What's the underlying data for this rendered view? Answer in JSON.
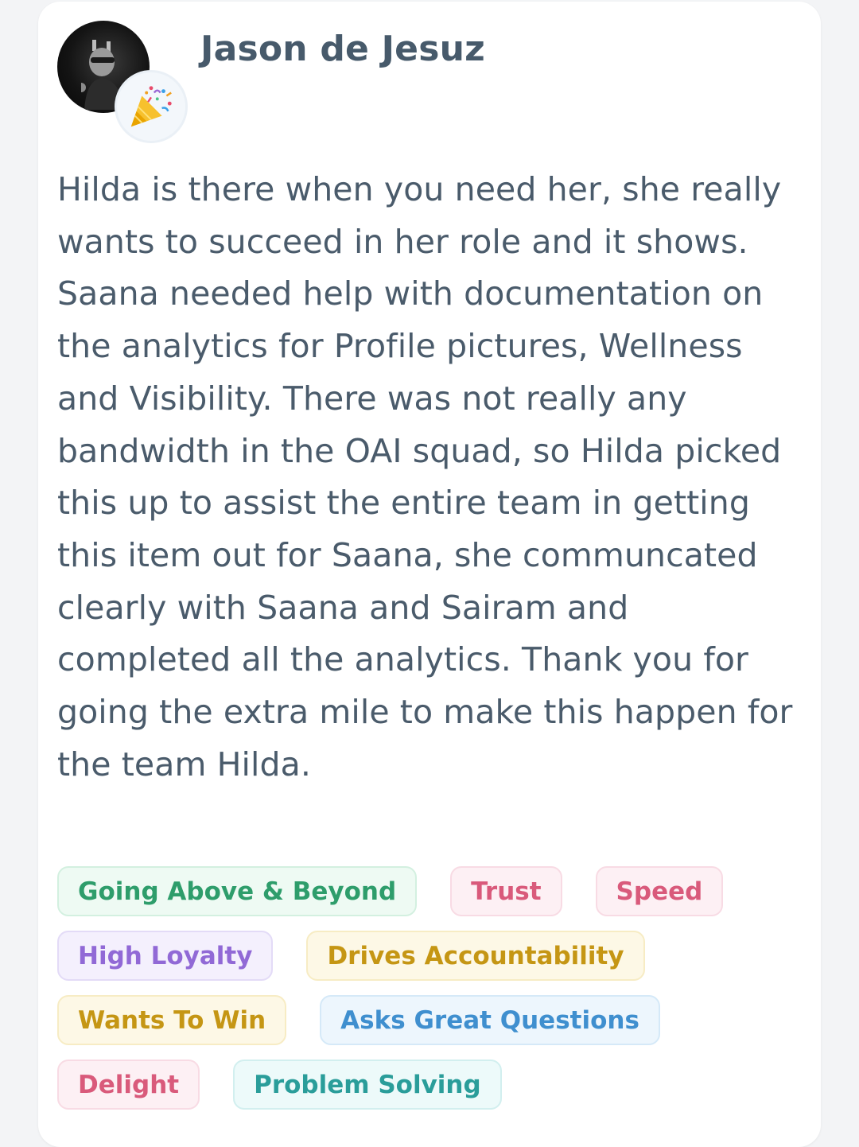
{
  "author": {
    "name": "Jason de Jesuz",
    "badge_icon": "party-popper-icon"
  },
  "message": "Hilda is there when you need her, she really wants to succeed in her role and it shows. Saana needed help with documentation on the analytics for Profile pictures, Wellness and Visibility. There was not really any bandwidth in the OAI squad, so Hilda picked this up to assist the entire team in getting this item out for Saana, she communcated clearly with Saana and Sairam and completed all the analytics. Thank you for going the extra mile to make this happen for the team Hilda.",
  "tags": [
    {
      "label": "Going Above & Beyond",
      "color": "#2e9d6b",
      "bg": "#eefaf3",
      "border": "#d3f0e0"
    },
    {
      "label": "Trust",
      "color": "#d95a7b",
      "bg": "#fdf0f4",
      "border": "#f8dbe4"
    },
    {
      "label": "Speed",
      "color": "#d95a7b",
      "bg": "#fdf0f4",
      "border": "#f8dbe4"
    },
    {
      "label": "High Loyalty",
      "color": "#9169d6",
      "bg": "#f4f0fd",
      "border": "#e3dbf7"
    },
    {
      "label": "Drives Accountability",
      "color": "#c59614",
      "bg": "#fdf8e6",
      "border": "#f7ecc4"
    },
    {
      "label": "Wants To Win",
      "color": "#c59614",
      "bg": "#fdf8e6",
      "border": "#f7ecc4"
    },
    {
      "label": "Asks Great Questions",
      "color": "#3f8fcf",
      "bg": "#edf6fd",
      "border": "#d5e9f8"
    },
    {
      "label": "Delight",
      "color": "#d95a7b",
      "bg": "#fdf0f4",
      "border": "#f8dbe4"
    },
    {
      "label": "Problem Solving",
      "color": "#2a9d9a",
      "bg": "#edfafa",
      "border": "#d2efef"
    }
  ]
}
